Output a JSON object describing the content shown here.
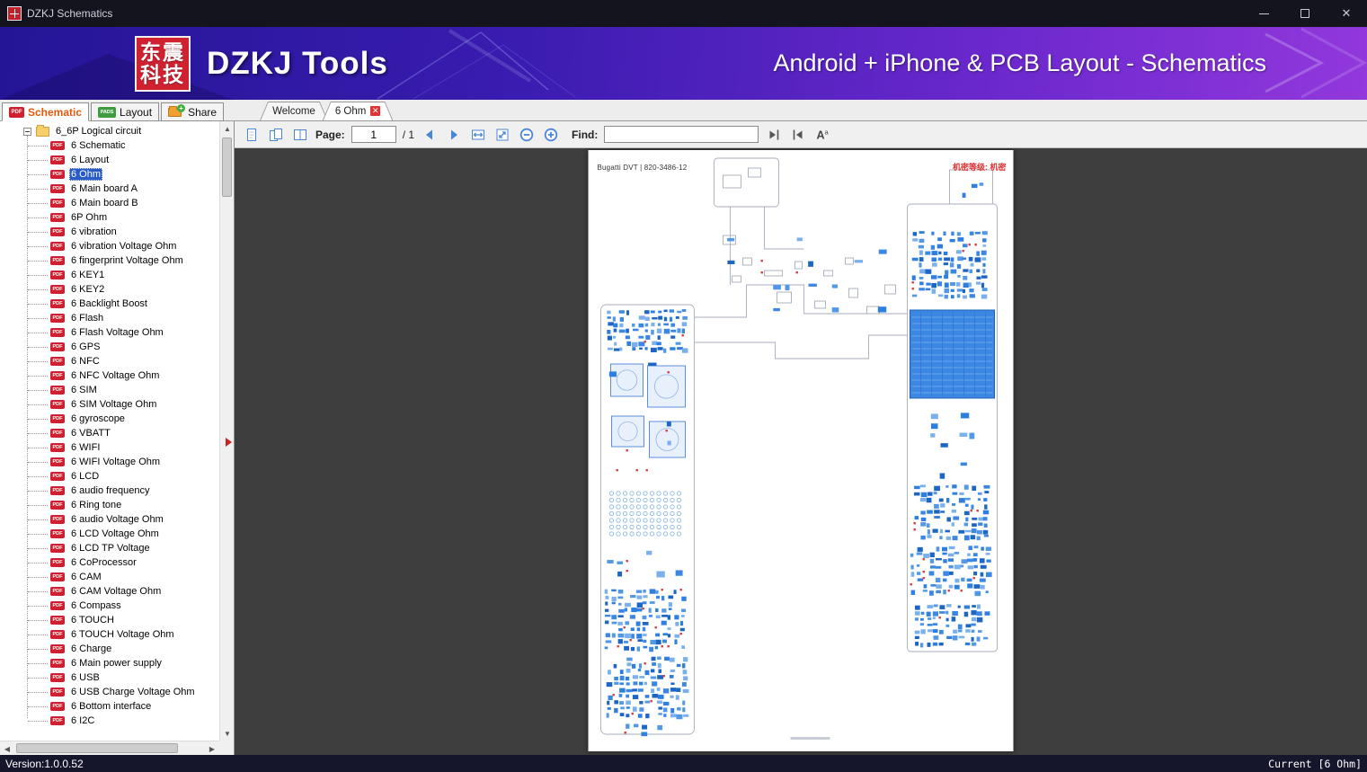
{
  "window": {
    "title": "DZKJ Schematics"
  },
  "banner": {
    "logo_line1": "东震",
    "logo_line2": "科技",
    "app_name": "DZKJ Tools",
    "tagline": "Android + iPhone & PCB Layout - Schematics"
  },
  "badges": {
    "pdf": "PDF",
    "pads": "PADS"
  },
  "ribbon_tabs": [
    {
      "label": "Schematic",
      "icon": "pdf-icon",
      "active": true
    },
    {
      "label": "Layout",
      "icon": "pads-icon",
      "active": false
    },
    {
      "label": "Share",
      "icon": "share-icon",
      "active": false
    }
  ],
  "document_tabs": [
    {
      "label": "Welcome",
      "active": false,
      "closable": false
    },
    {
      "label": "6 Ohm",
      "active": true,
      "closable": true
    }
  ],
  "toolbar": {
    "page_label": "Page:",
    "page_value": "1",
    "page_total": "/ 1",
    "find_label": "Find:",
    "find_value": ""
  },
  "tree": {
    "root_label": "6_6P Logical circuit",
    "items": [
      {
        "label": "6 Schematic"
      },
      {
        "label": "6 Layout"
      },
      {
        "label": "6 Ohm",
        "selected": true
      },
      {
        "label": "6 Main board A"
      },
      {
        "label": "6 Main board B"
      },
      {
        "label": "6P Ohm"
      },
      {
        "label": "6 vibration"
      },
      {
        "label": "6 vibration Voltage Ohm"
      },
      {
        "label": "6 fingerprint Voltage Ohm"
      },
      {
        "label": "6 KEY1"
      },
      {
        "label": "6 KEY2"
      },
      {
        "label": "6 Backlight Boost"
      },
      {
        "label": "6 Flash"
      },
      {
        "label": "6 Flash Voltage Ohm"
      },
      {
        "label": "6 GPS"
      },
      {
        "label": "6 NFC"
      },
      {
        "label": "6 NFC Voltage Ohm"
      },
      {
        "label": "6 SIM"
      },
      {
        "label": "6 SIM Voltage Ohm"
      },
      {
        "label": "6 gyroscope"
      },
      {
        "label": "6 VBATT"
      },
      {
        "label": "6 WIFI"
      },
      {
        "label": "6 WIFI Voltage Ohm"
      },
      {
        "label": "6 LCD"
      },
      {
        "label": "6 audio frequency"
      },
      {
        "label": "6 Ring tone"
      },
      {
        "label": "6 audio Voltage Ohm"
      },
      {
        "label": "6 LCD Voltage Ohm"
      },
      {
        "label": "6 LCD TP Voltage"
      },
      {
        "label": "6 CoProcessor"
      },
      {
        "label": "6 CAM"
      },
      {
        "label": "6 CAM Voltage Ohm"
      },
      {
        "label": "6 Compass"
      },
      {
        "label": "6 TOUCH"
      },
      {
        "label": "6 TOUCH Voltage Ohm"
      },
      {
        "label": "6 Charge"
      },
      {
        "label": "6 Main power supply"
      },
      {
        "label": "6 USB"
      },
      {
        "label": "6 USB Charge Voltage Ohm"
      },
      {
        "label": "6 Bottom interface"
      },
      {
        "label": "6 I2C"
      }
    ]
  },
  "viewer": {
    "doc_id": "Bugatti DVT | 820-3486-12",
    "classification": "机密等级: 机密"
  },
  "status": {
    "version": "Version:1.0.0.52",
    "current": "Current [6 Ohm]"
  }
}
